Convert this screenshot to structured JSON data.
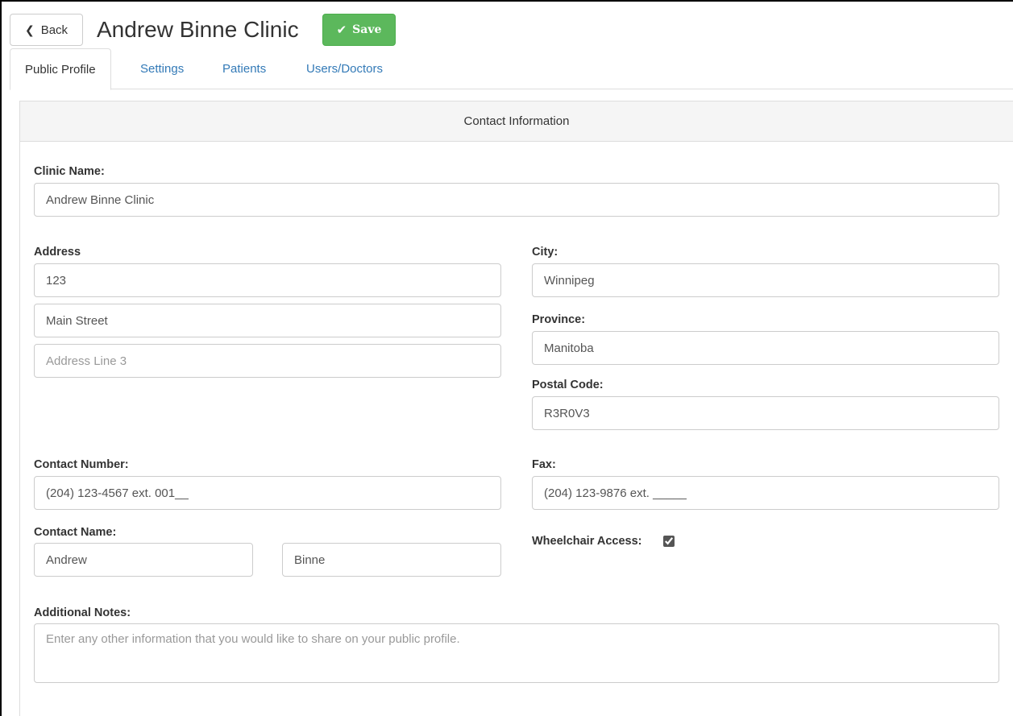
{
  "header": {
    "back_label": "Back",
    "title": "Andrew Binne Clinic",
    "save_label": "Save"
  },
  "tabs": [
    {
      "label": "Public Profile",
      "active": true
    },
    {
      "label": "Settings",
      "active": false
    },
    {
      "label": "Patients",
      "active": false
    },
    {
      "label": "Users/Doctors",
      "active": false
    }
  ],
  "panel": {
    "heading": "Contact Information"
  },
  "form": {
    "clinic_name": {
      "label": "Clinic Name:",
      "value": "Andrew Binne Clinic"
    },
    "address": {
      "label": "Address",
      "line1": "123",
      "line2": "Main Street",
      "line3_placeholder": "Address Line 3"
    },
    "city": {
      "label": "City:",
      "value": "Winnipeg"
    },
    "province": {
      "label": "Province:",
      "value": "Manitoba"
    },
    "postal_code": {
      "label": "Postal Code:",
      "value": "R3R0V3"
    },
    "contact_number": {
      "label": "Contact Number:",
      "value": "(204) 123-4567 ext. 001__"
    },
    "fax": {
      "label": "Fax:",
      "value": "(204) 123-9876 ext. _____"
    },
    "contact_name": {
      "label": "Contact Name:",
      "first": "Andrew",
      "last": "Binne"
    },
    "wheelchair": {
      "label": "Wheelchair Access:",
      "checked": true
    },
    "notes": {
      "label": "Additional Notes:",
      "placeholder": "Enter any other information that you would like to share on your public profile."
    }
  },
  "colors": {
    "save": "#5cb85c",
    "link": "#337ab7",
    "panel_heading_bg": "#f5f5f5"
  }
}
